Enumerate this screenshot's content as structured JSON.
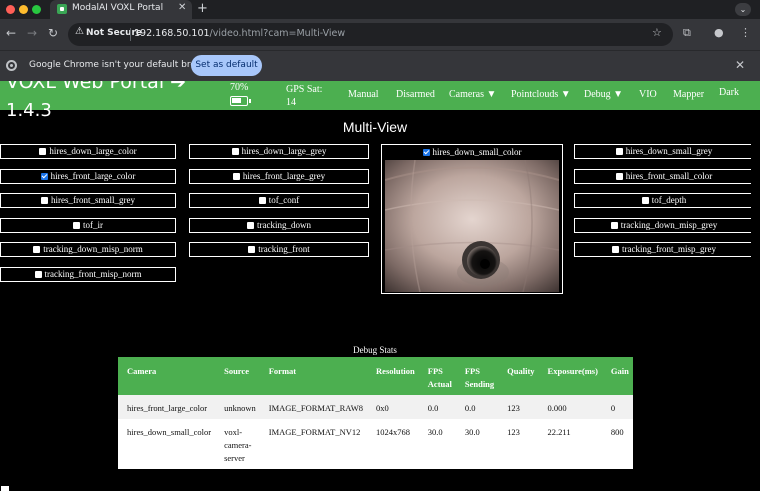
{
  "browser": {
    "tab_title": "ModalAI VOXL Portal",
    "security_label": "Not Secure",
    "url_host": "192.168.50.101",
    "url_path": "/video.html?cam=Multi-View",
    "infobar_message": "Google Chrome isn't your default browser",
    "default_button": "Set as default"
  },
  "navbar": {
    "brand": "VOXL Web Portal ➔",
    "version": "1.4.3",
    "battery_pct": "70%",
    "battery_level": 0.7,
    "gps_label": "GPS Sat:",
    "gps_value": "14",
    "items": {
      "manual": "Manual",
      "disarmed": "Disarmed",
      "cameras": "Cameras ▼",
      "pointclouds": "Pointclouds ▼",
      "debug": "Debug ▼",
      "vio": "VIO",
      "mapper": "Mapper",
      "dark": "Dark"
    }
  },
  "page": {
    "title": "Multi-View"
  },
  "cameras": {
    "col1": [
      {
        "label": "hires_down_large_color",
        "checked": false
      },
      {
        "label": "hires_front_large_color",
        "checked": true
      },
      {
        "label": "hires_front_small_grey",
        "checked": false
      },
      {
        "label": "tof_ir",
        "checked": false
      },
      {
        "label": "tracking_down_misp_norm",
        "checked": false
      },
      {
        "label": "tracking_front_misp_norm",
        "checked": false
      }
    ],
    "col2": [
      {
        "label": "hires_down_large_grey",
        "checked": false
      },
      {
        "label": "hires_front_large_grey",
        "checked": false
      },
      {
        "label": "tof_conf",
        "checked": false
      },
      {
        "label": "tracking_down",
        "checked": false
      },
      {
        "label": "tracking_front",
        "checked": false
      }
    ],
    "center": {
      "label": "hires_down_small_color",
      "checked": true
    },
    "col4": [
      {
        "label": "hires_down_small_grey",
        "checked": false
      },
      {
        "label": "hires_front_small_color",
        "checked": false
      },
      {
        "label": "tof_depth",
        "checked": false
      },
      {
        "label": "tracking_down_misp_grey",
        "checked": false
      },
      {
        "label": "tracking_front_misp_grey",
        "checked": false
      }
    ]
  },
  "debug_stats": {
    "title": "Debug Stats",
    "headers": [
      "Camera",
      "Source",
      "Format",
      "Resolution",
      "FPS Actual",
      "FPS Sending",
      "Quality",
      "Exposure(ms)",
      "Gain"
    ],
    "rows": [
      [
        "hires_front_large_color",
        "unknown",
        "IMAGE_FORMAT_RAW8",
        "0x0",
        "0.0",
        "0.0",
        "123",
        "0.000",
        "0"
      ],
      [
        "hires_down_small_color",
        "voxl-camera-server",
        "IMAGE_FORMAT_NV12",
        "1024x768",
        "30.0",
        "30.0",
        "123",
        "22.211",
        "800"
      ]
    ]
  },
  "colors": {
    "accent_green": "#4caf50",
    "checkbox_blue": "#1a73e8"
  }
}
